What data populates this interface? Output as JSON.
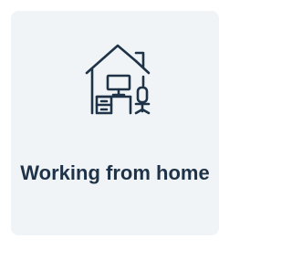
{
  "card": {
    "icon": "home-office-icon",
    "title": "Working from home",
    "colors": {
      "background": "#f1f4f6",
      "text": "#1f3348",
      "icon_stroke": "#1f3348"
    }
  }
}
